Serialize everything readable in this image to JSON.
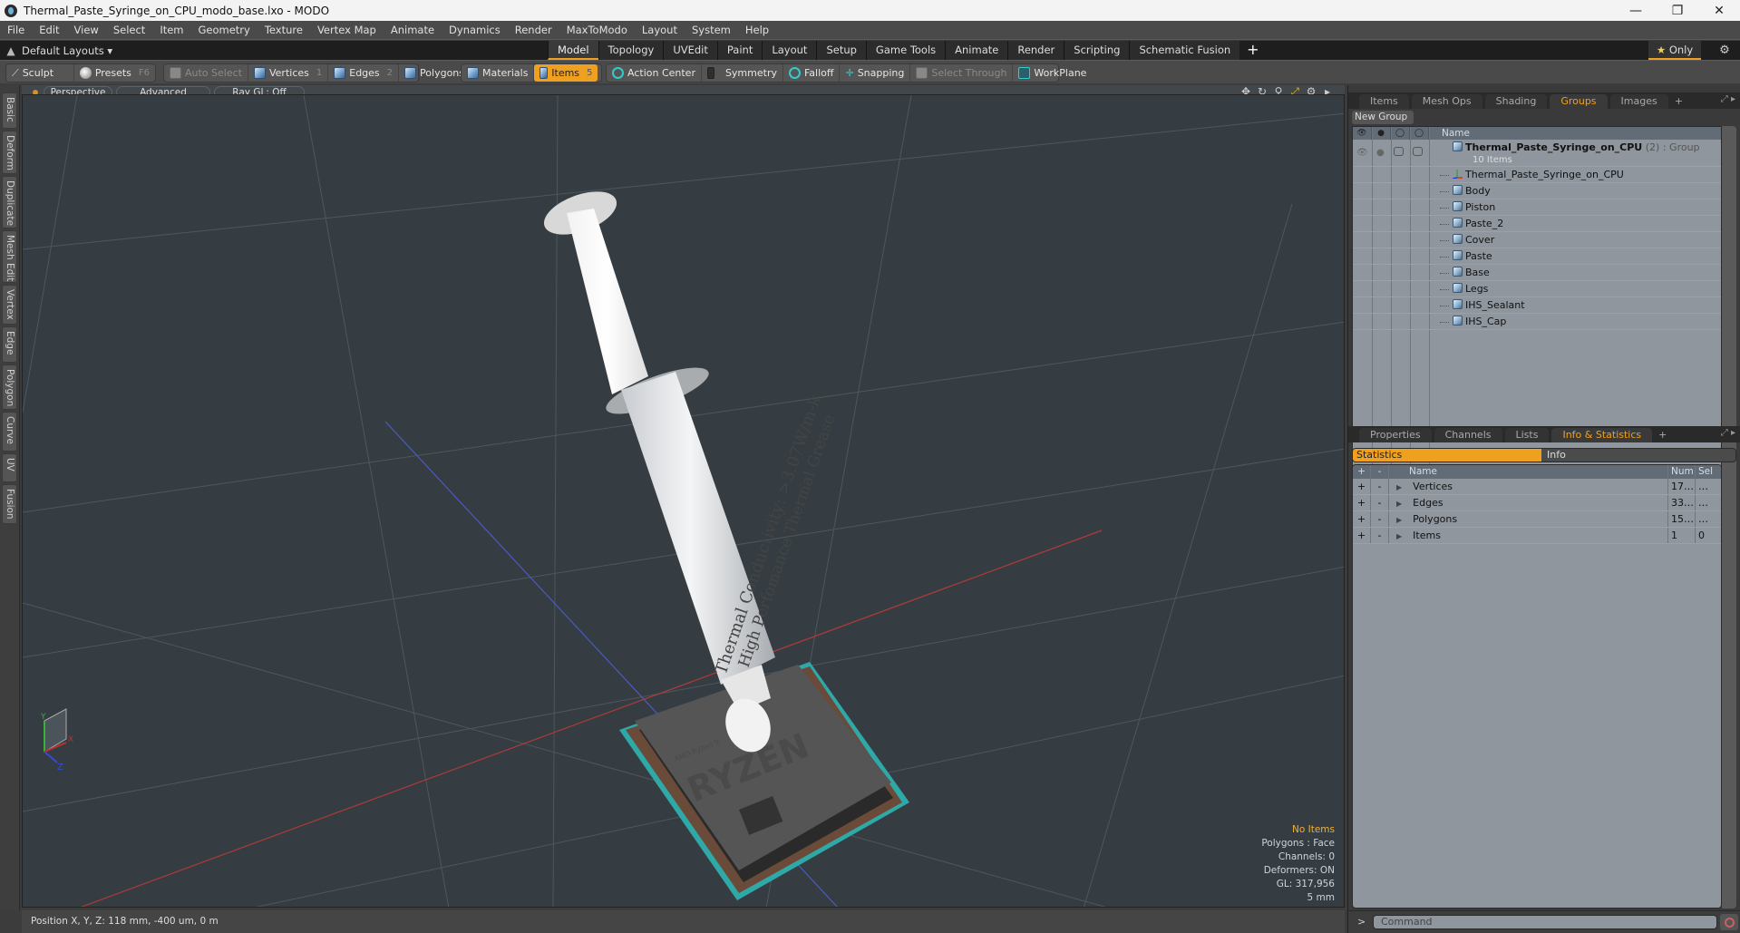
{
  "window": {
    "title": "Thermal_Paste_Syringe_on_CPU_modo_base.lxo - MODO",
    "controls": {
      "minimize": "—",
      "maximize": "❐",
      "close": "✕"
    }
  },
  "menu": [
    "File",
    "Edit",
    "View",
    "Select",
    "Item",
    "Geometry",
    "Texture",
    "Vertex Map",
    "Animate",
    "Dynamics",
    "Render",
    "MaxToModo",
    "Layout",
    "System",
    "Help"
  ],
  "layoutbar": {
    "layout_name": "Default Layouts ▾",
    "tabs": [
      "Model",
      "Topology",
      "UVEdit",
      "Paint",
      "Layout",
      "Setup",
      "Game Tools",
      "Animate",
      "Render",
      "Scripting",
      "Schematic Fusion"
    ],
    "active_tab": "Model",
    "add_tab": "+",
    "only_label": "Only",
    "only_star": "★",
    "gear": "⚙"
  },
  "toolbar": {
    "sculpt": "Sculpt",
    "presets": "Presets",
    "presets_key": "F6",
    "auto_select": "Auto Select",
    "vertices": "Vertices",
    "vertices_key": "1",
    "edges": "Edges",
    "edges_key": "2",
    "polygons": "Polygons",
    "materials": "Materials",
    "items": "Items",
    "items_key": "5",
    "action_center": "Action Center",
    "symmetry": "Symmetry",
    "falloff": "Falloff",
    "snapping": "Snapping",
    "select_through": "Select Through",
    "workplane": "WorkPlane"
  },
  "left_tabs": [
    "Basic",
    "Deform",
    "Duplicate",
    "Mesh Edit",
    "Vertex",
    "Edge",
    "Polygon",
    "Curve",
    "UV",
    "Fusion"
  ],
  "viewport": {
    "view_mode": "Perspective",
    "shading": "Advanced",
    "raygl": "Ray GL: Off",
    "icons": [
      "move-icon",
      "rotate-icon",
      "zoom-icon",
      "fit-icon",
      "settings-icon",
      "expand-icon"
    ],
    "info": {
      "selection": "No Items",
      "polygons": "Polygons : Face",
      "channels": "Channels: 0",
      "deformers": "Deformers: ON",
      "gl": "GL: 317,956",
      "scale": "5 mm"
    },
    "syringe_label_1": "Thermal Conductivity: >3.07W/m-k",
    "syringe_label_2": "High Perfomance Thermal Grease",
    "cpu_brand": "RYZEN",
    "cpu_small": "AMD Ryzen 9",
    "axis_labels": {
      "x": "X",
      "y": "Y",
      "z": "Z"
    }
  },
  "status": {
    "position": "Position X, Y, Z:   118 mm, -400 um, 0 m"
  },
  "right_top": {
    "tabs": [
      "Items",
      "Mesh Ops",
      "Shading",
      "Groups",
      "Images"
    ],
    "active_tab": "Groups",
    "add": "+",
    "new_group": "New Group",
    "column_name": "Name",
    "group": {
      "name": "Thermal_Paste_Syringe_on_CPU",
      "count": "(2)",
      "type": ": Group",
      "sub": "10 Items"
    },
    "items": [
      {
        "name": "Thermal_Paste_Syringe_on_CPU",
        "kind": "locator"
      },
      {
        "name": "Body",
        "kind": "mesh"
      },
      {
        "name": "Piston",
        "kind": "mesh"
      },
      {
        "name": "Paste_2",
        "kind": "mesh"
      },
      {
        "name": "Cover",
        "kind": "mesh"
      },
      {
        "name": "Paste",
        "kind": "mesh"
      },
      {
        "name": "Base",
        "kind": "mesh"
      },
      {
        "name": "Legs",
        "kind": "mesh"
      },
      {
        "name": "IHS_Sealant",
        "kind": "mesh"
      },
      {
        "name": "IHS_Cap",
        "kind": "mesh"
      }
    ]
  },
  "right_bottom": {
    "tabs": [
      "Properties",
      "Channels",
      "Lists",
      "Info & Statistics"
    ],
    "active_tab": "Info & Statistics",
    "add": "+",
    "toggle": {
      "statistics": "Statistics",
      "info": "Info"
    },
    "columns": {
      "plus": "+",
      "minus": "-",
      "name": "Name",
      "num": "Num",
      "sel": "Sel"
    },
    "rows": [
      {
        "name": "Vertices",
        "num": "17…",
        "sel": "…"
      },
      {
        "name": "Edges",
        "num": "33…",
        "sel": "…"
      },
      {
        "name": "Polygons",
        "num": "15…",
        "sel": "…"
      },
      {
        "name": "Items",
        "num": "1",
        "sel": "0"
      }
    ]
  },
  "command": {
    "prompt": ">",
    "placeholder": "Command"
  },
  "colors": {
    "accent": "#f0a020",
    "viewport_bg": "#353d42",
    "list_bg": "#8f969e"
  }
}
